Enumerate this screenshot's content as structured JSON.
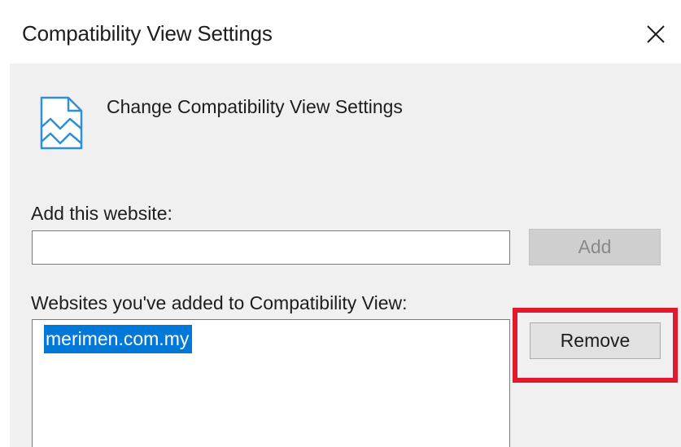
{
  "dialog": {
    "title": "Compatibility View Settings",
    "close_icon": "close-icon"
  },
  "header": {
    "icon": "compatibility-view-icon",
    "text": "Change Compatibility View Settings"
  },
  "add_website": {
    "label": "Add this website:",
    "value": "",
    "placeholder": "",
    "button_label": "Add",
    "button_enabled": false
  },
  "websites": {
    "label": "Websites you've added to Compatibility View:",
    "items": [
      "merimen.com.my"
    ],
    "selected_index": 0,
    "remove_label": "Remove"
  },
  "colors": {
    "selection": "#0078d7",
    "highlight_annotation": "#e01a2a",
    "panel_background": "#f0f0f0"
  }
}
